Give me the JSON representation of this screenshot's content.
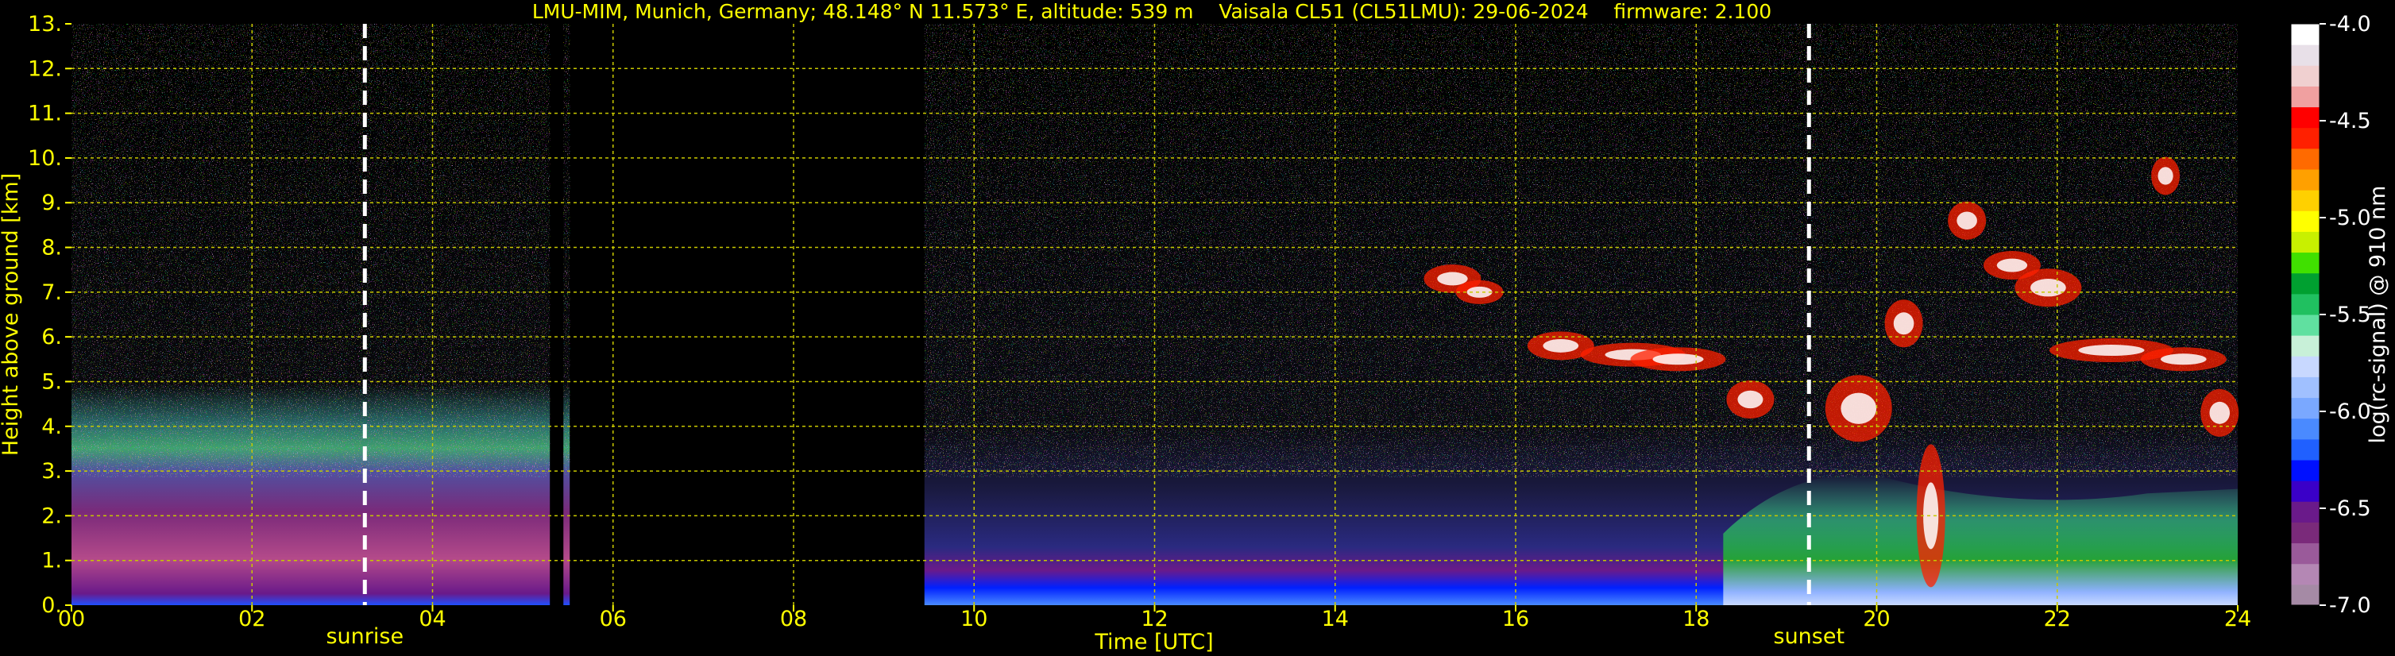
{
  "header": {
    "title": "LMU-MIM, Munich, Germany; 48.148° N 11.573° E, altitude: 539 m    Vaisala CL51 (CL51LMU): 29-06-2024    firmware: 2.100"
  },
  "chart_data": {
    "type": "heatmap",
    "xlabel": "Time [UTC]",
    "ylabel": "Height above ground [km]",
    "xlim": [
      0,
      24
    ],
    "ylim": [
      0,
      13
    ],
    "x_ticks": [
      "00",
      "02",
      "04",
      "06",
      "08",
      "10",
      "12",
      "14",
      "16",
      "18",
      "20",
      "22",
      "24"
    ],
    "y_ticks": [
      "0.",
      "1.",
      "2.",
      "3.",
      "4.",
      "5.",
      "6.",
      "7.",
      "8.",
      "9.",
      "10.",
      "11.",
      "12.",
      "13."
    ],
    "grid": true,
    "annotations": [
      {
        "label": "sunrise",
        "x": 3.25
      },
      {
        "label": "sunset",
        "x": 19.25
      }
    ],
    "data_gaps_utc": [
      [
        5.3,
        5.45
      ],
      [
        5.52,
        9.45
      ]
    ],
    "colorbar": {
      "label": "log(rc-signal) @ 910 nm",
      "range": [
        -7.0,
        -4.0
      ],
      "ticks": [
        "-4.0",
        "-4.5",
        "-5.0",
        "-5.5",
        "-6.0",
        "-6.5",
        "-7.0"
      ],
      "colors": [
        "#a58aa5",
        "#b487b4",
        "#9a5a9a",
        "#7a2a7a",
        "#6a1a8a",
        "#3a00c8",
        "#0010ff",
        "#2060ff",
        "#4a8aff",
        "#7aa8ff",
        "#a0c0ff",
        "#c8d8ff",
        "#c8f0d8",
        "#60e0a0",
        "#20c060",
        "#00a030",
        "#40e000",
        "#c8f000",
        "#ffff00",
        "#ffd000",
        "#ffa000",
        "#ff6a00",
        "#ff2000",
        "#ff0000",
        "#f0a0a0",
        "#f0d0d0",
        "#e8e0e8",
        "#ffffff"
      ]
    }
  }
}
